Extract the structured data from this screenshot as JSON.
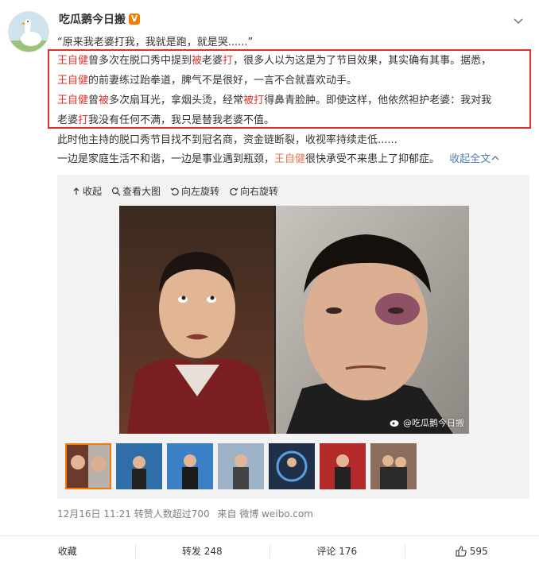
{
  "post": {
    "author": "吃瓜鹅今日搬",
    "vbadge": "V",
    "quote": "“原来我老婆打我，我就是跑，就是哭......”",
    "box_lines": [
      [
        "王自健",
        "曾多次在脱口秀中提到",
        "被",
        "老婆",
        "打",
        "，很多人以为这是为了节目效果，其实确有其事。据悉，"
      ],
      [
        "王自健",
        "的前妻练过跆拳道，脾气不是很好，一言不合就喜欢动手。"
      ],
      [
        "王自健",
        "曾",
        "被",
        "多次扇耳光，拿烟头烫，经常",
        "被打",
        "得鼻青脸肿。即使这样，他依然袒护老婆：我对我"
      ],
      [
        "老婆",
        "打",
        "我没有任何不满，我只是替我老婆不值。"
      ]
    ],
    "line5": "此时他主持的脱口秀节目找不到冠名商，资金链断裂，收视率持续走低......",
    "line6_a": "一边是家庭生活不和谐，一边是事业遇到瓶颈，",
    "line6_name": "王自健",
    "line6_b": "很快承受不来患上了抑郁症。",
    "collapse": "收起全文",
    "collapse_icon": "chevron-up"
  },
  "toolbar": {
    "collapse": "收起",
    "view_large": "查看大图",
    "rotate_left": "向左旋转",
    "rotate_right": "向右旋转"
  },
  "image": {
    "watermark": "@吃瓜鹅今日搬"
  },
  "meta": {
    "date": "12月16日 11:21",
    "likes_note": "转赞人数超过700",
    "source_prefix": "来自",
    "source": "微博 weibo.com"
  },
  "actions": {
    "favorite": "收藏",
    "forward": "转发 248",
    "comment": "评论 176",
    "like": "595"
  },
  "colors": {
    "highlight": "#e0312d",
    "link": "#eb7350",
    "collapse": "#507daf",
    "badge": "#f57b00"
  }
}
